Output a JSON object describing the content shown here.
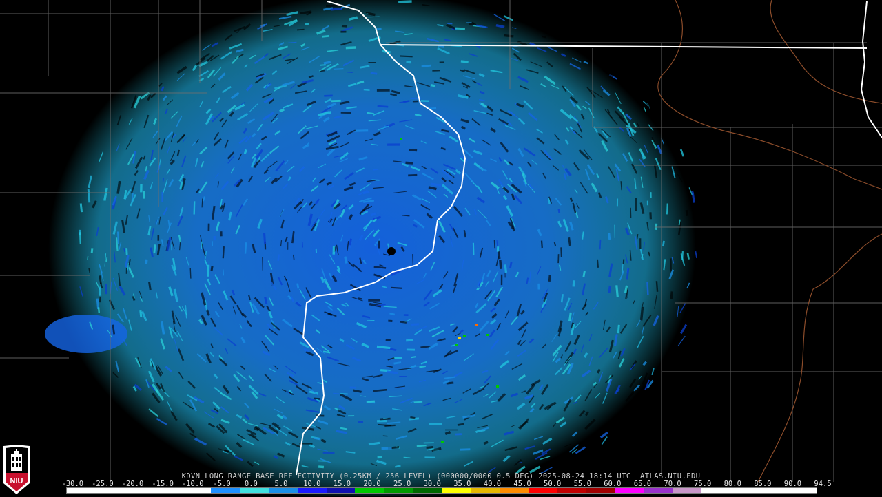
{
  "product": {
    "caption": "KDVN LONG RANGE BASE REFLECTIVITY (0.25KM / 256 LEVEL) (000000/0000 0.5 DEG) 2025-08-24 18:14 UTC  ATLAS.NIU.EDU"
  },
  "logo": {
    "text": "NIU",
    "icon": "niu-seal-icon"
  },
  "scale": {
    "labels": [
      "-30.0",
      "-25.0",
      "-20.0",
      "-15.0",
      "-10.0",
      "-5.0",
      "0.0",
      "5.0",
      "10.0",
      "15.0",
      "20.0",
      "25.0",
      "30.0",
      "35.0",
      "40.0",
      "45.0",
      "50.0",
      "55.0",
      "60.0",
      "65.0",
      "70.0",
      "75.0",
      "80.0",
      "85.0",
      "90.0",
      "94.5"
    ],
    "colors": [
      "#ffffff",
      "#ffffff",
      "#ffffff",
      "#ffffff",
      "#ffffff",
      "#1e90ff",
      "#40e0e0",
      "#1a8fe6",
      "#1a1aff",
      "#1010b0",
      "#00c800",
      "#009a00",
      "#006800",
      "#ffff00",
      "#e6b800",
      "#ff8c00",
      "#ff0000",
      "#c00000",
      "#a00000",
      "#ff00ff",
      "#9932cc",
      "#c896c8",
      "#ffffff",
      "#ffffff",
      "#ffffff",
      "#ffffff"
    ]
  },
  "map_colors": {
    "background": "#000000",
    "state_border": "#ffffff",
    "county_lines": "#6e6e6e",
    "rivers": "#8b4c2a"
  }
}
